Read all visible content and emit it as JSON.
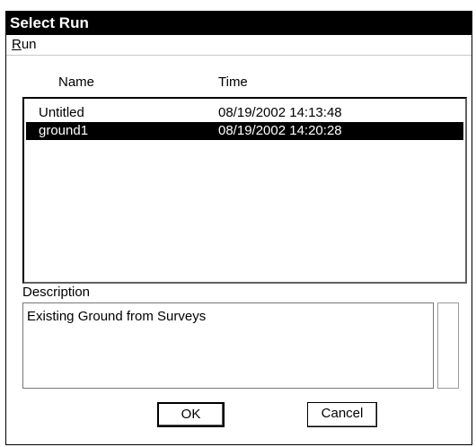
{
  "window": {
    "title": "Select Run"
  },
  "menu": {
    "run_mnemonic": "R",
    "run_rest": "un"
  },
  "list": {
    "headers": {
      "name": "Name",
      "time": "Time"
    },
    "rows": [
      {
        "name": "Untitled",
        "time": "08/19/2002 14:13:48",
        "selected": false
      },
      {
        "name": "ground1",
        "time": "08/19/2002 14:20:28",
        "selected": true
      }
    ]
  },
  "description": {
    "label": "Description",
    "text": "Existing Ground from Surveys"
  },
  "buttons": {
    "ok": "OK",
    "cancel": "Cancel"
  }
}
